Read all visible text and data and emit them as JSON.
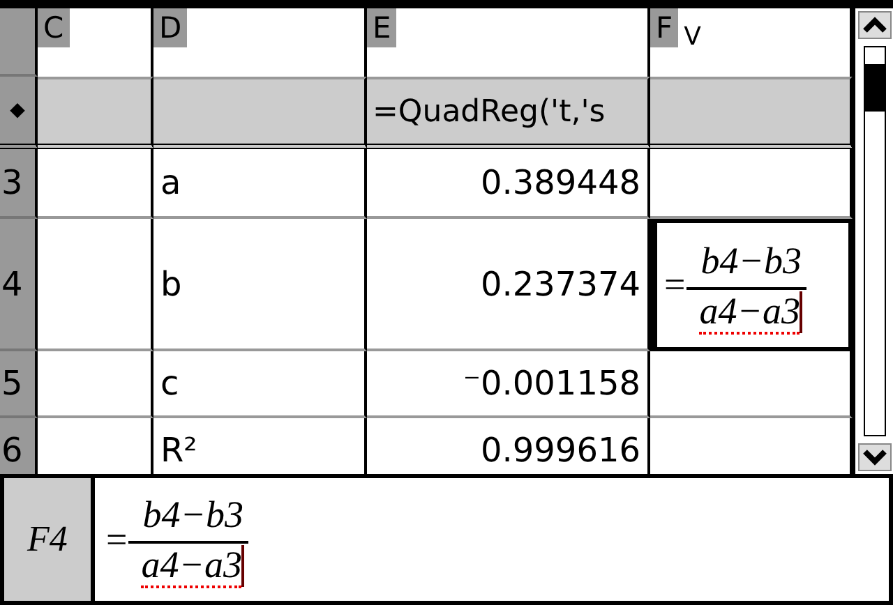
{
  "columns": [
    {
      "label": "C"
    },
    {
      "label": "D"
    },
    {
      "label": "E"
    },
    {
      "label": "F",
      "note": "V"
    }
  ],
  "formula_row": {
    "marker": "◆",
    "cells": [
      {
        "selected": false
      },
      {
        "selected": false
      },
      {
        "text": "=QuadReg('t,'s",
        "selected": false
      },
      {
        "selected": false
      }
    ]
  },
  "rows": [
    {
      "label": "3",
      "cells": [
        {
          "selected": false
        },
        {
          "text": "a",
          "selected": false
        },
        {
          "text": "0.389448",
          "selected": false
        },
        {
          "selected": false
        }
      ]
    },
    {
      "label": "4",
      "cells": [
        {
          "selected": false
        },
        {
          "text": "b",
          "selected": false
        },
        {
          "text": "0.237374",
          "selected": false
        },
        {
          "kind": "fraction",
          "prefix": "=",
          "numerator": "b4−b3",
          "denominator": "a4−a3",
          "selected": true
        }
      ]
    },
    {
      "label": "5",
      "cells": [
        {
          "selected": false
        },
        {
          "text": "c",
          "selected": false
        },
        {
          "text": "⁻0.001158",
          "selected": false
        },
        {
          "selected": false
        }
      ]
    },
    {
      "label": "6",
      "cells": [
        {
          "selected": false
        },
        {
          "text": "R²",
          "selected": false
        },
        {
          "text": "0.999616",
          "selected": false
        },
        {
          "selected": false
        }
      ]
    }
  ],
  "entry_line": {
    "cell_ref": "F4",
    "prefix": "=",
    "numerator": "b4−b3",
    "denominator": "a4−a3"
  }
}
